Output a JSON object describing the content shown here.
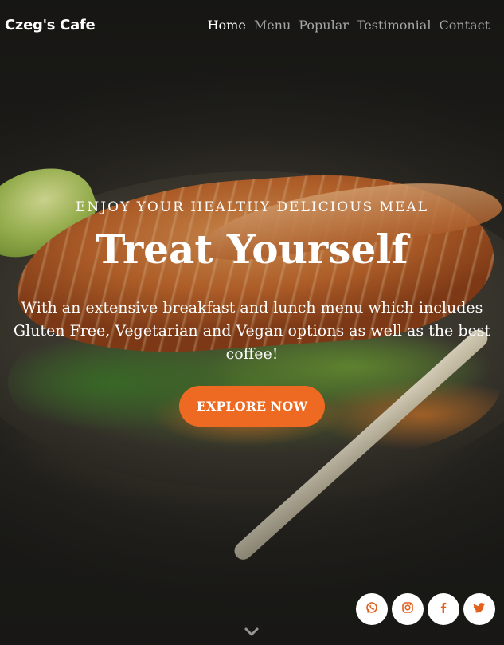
{
  "nav": {
    "brand": "Czeg's Cafe",
    "links": [
      {
        "label": "Home",
        "active": true
      },
      {
        "label": "Menu",
        "active": false
      },
      {
        "label": "Popular",
        "active": false
      },
      {
        "label": "Testimonial",
        "active": false
      },
      {
        "label": "Contact",
        "active": false
      }
    ]
  },
  "hero": {
    "eyebrow": "ENJOY YOUR HEALTHY DELICIOUS MEAL",
    "headline": "Treat Yourself",
    "subtext": "With an extensive breakfast and lunch menu which includes Gluten Free, Vegetarian and Vegan options as well as the best coffee!",
    "cta_label": "EXPLORE NOW"
  },
  "social": {
    "icons": [
      "whatsapp-icon",
      "instagram-icon",
      "facebook-icon",
      "twitter-icon"
    ]
  },
  "scroll": {
    "icon": "chevron-down-icon"
  },
  "colors": {
    "accent": "#ee6a22",
    "icon": "#e25f1c",
    "text": "#ffffff"
  }
}
